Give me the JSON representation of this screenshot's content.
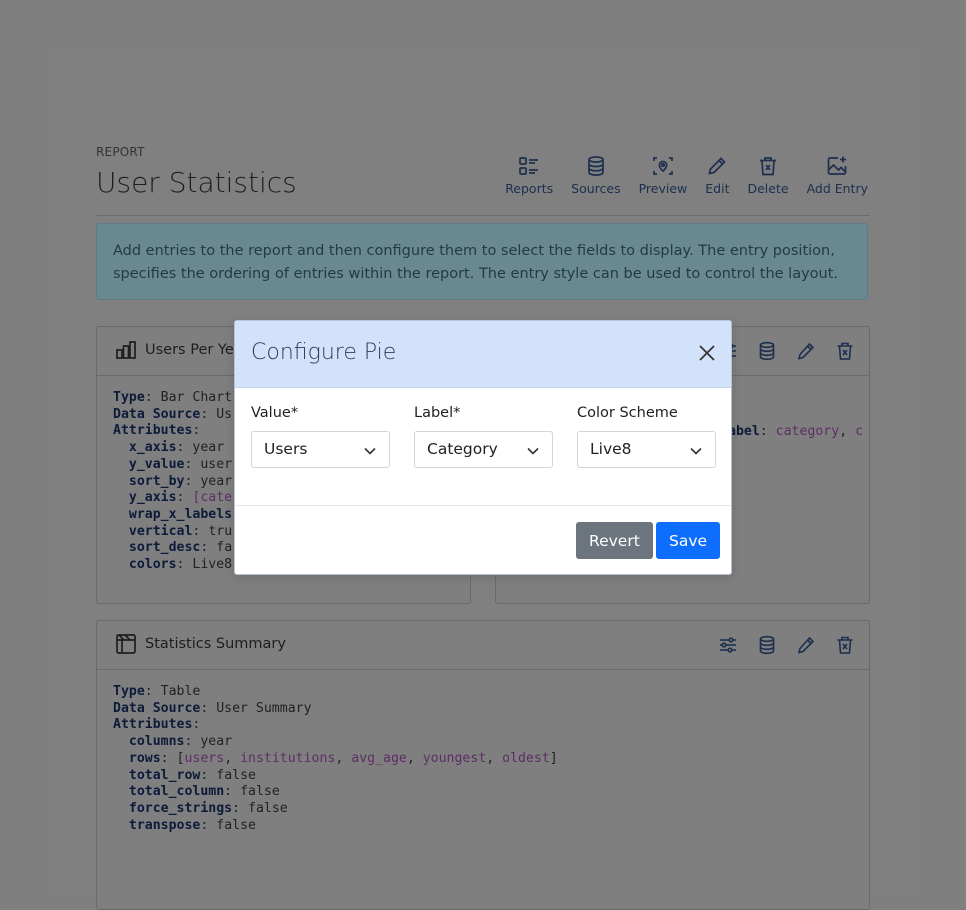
{
  "header": {
    "overline": "REPORT",
    "title": "User Statistics",
    "toolbar": [
      {
        "label": "Reports",
        "icon": "list-icon"
      },
      {
        "label": "Sources",
        "icon": "database-icon"
      },
      {
        "label": "Preview",
        "icon": "preview-icon"
      },
      {
        "label": "Edit",
        "icon": "pencil-icon"
      },
      {
        "label": "Delete",
        "icon": "trash-icon"
      },
      {
        "label": "Add Entry",
        "icon": "add-image-icon"
      }
    ]
  },
  "info": {
    "text": "Add entries to the report and then configure them to select the fields to display. The entry position, specifies the ordering of entries within the report. The entry style can be used to control the layout."
  },
  "card1": {
    "title": "Users Per Yea",
    "lines": [
      {
        "key": "Type",
        "value": "Bar Chart"
      },
      {
        "key": "Data Source",
        "value": "Us"
      },
      {
        "key": "Attributes",
        "value": ""
      },
      {
        "key": "x_axis",
        "value": "year"
      },
      {
        "key": "y_value",
        "value": "user"
      },
      {
        "key": "sort_by",
        "value": "year"
      },
      {
        "key": "y_axis",
        "value": "[cate"
      },
      {
        "key": "wrap_x_labels",
        "value": ""
      },
      {
        "key": "vertical",
        "value": "tru"
      },
      {
        "key": "sort_desc",
        "value": "fa"
      },
      {
        "key": "colors",
        "value": "Live8"
      }
    ]
  },
  "card2": {
    "partial_key": "abel",
    "partial_value": "category",
    "partial_tail": "c"
  },
  "card3": {
    "title": "Statistics Summary",
    "type_key": "Type",
    "type_value": "Table",
    "source_key": "Data Source",
    "source_value": "User Summary",
    "attributes_key": "Attributes",
    "columns_key": "columns",
    "columns_value": "year",
    "rows_key": "rows",
    "rows": [
      "users",
      "institutions",
      "avg_age",
      "youngest",
      "oldest"
    ],
    "total_row_key": "total_row",
    "total_row_value": "false",
    "total_column_key": "total_column",
    "total_column_value": "false",
    "force_strings_key": "force_strings",
    "force_strings_value": "false",
    "transpose_key": "transpose",
    "transpose_value": "false"
  },
  "modal": {
    "title": "Configure Pie",
    "fields": [
      {
        "label": "Value*",
        "value": "Users"
      },
      {
        "label": "Label*",
        "value": "Category"
      },
      {
        "label": "Color Scheme",
        "value": "Live8"
      }
    ],
    "revert_label": "Revert",
    "save_label": "Save"
  },
  "colors": {
    "primary": "#0d6efd",
    "secondary": "#6c757d",
    "modal_header": "#d3e2fb"
  }
}
